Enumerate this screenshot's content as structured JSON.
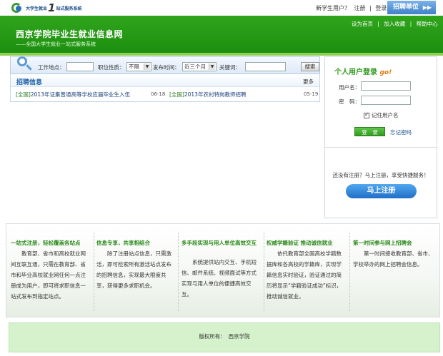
{
  "topbar": {
    "logo_left": "大学生就业",
    "logo_one": "1",
    "logo_right": "站式服务系统",
    "new_user": "新学生用户？",
    "register": "注册",
    "separator": "|",
    "login": "登录",
    "recruit_unit": "招聘单位",
    "recruit_arrow": "▶▶"
  },
  "banner": {
    "title": "西京学院毕业生就业信息网",
    "subtitle": "——全国大学生就业一站式服务系统",
    "links": [
      "设为首页",
      "|",
      "加入收藏",
      "|",
      "帮助中心"
    ]
  },
  "search": {
    "work_location_label": "工作地点：",
    "job_type_label": "职位性质：",
    "job_type_value": "不限",
    "publish_time_label": "发布时间：",
    "publish_time_value": "近三个月",
    "keyword_label": "关键词：",
    "search_button": "搜索"
  },
  "recruit_info": {
    "title": "招聘信息",
    "more": "更多",
    "jobs": [
      {
        "tag": "[全国]",
        "title": "2013年证集普通高等学校应届毕业生入伍",
        "date": "06-18"
      },
      {
        "tag": "[全国]",
        "title": "2013年农村特岗教师招聘",
        "date": "05-19"
      }
    ]
  },
  "login": {
    "title": "个人用户登录",
    "go": "go!",
    "username_label": "用户名：",
    "password_label": "密　码：",
    "remember_label": "记住用户名",
    "login_button": "登　录",
    "forgot_password": "忘记密码",
    "no_register_text": "还没有注册？马上注册，享受快捷服务！",
    "register_button": "马上注册"
  },
  "features": [
    {
      "title": "一站式注册，轻松覆盖各站点",
      "body": "教育部、省市和高校就业网间互联互通，只需在教育部、省市和毕业高校就业网任何一点注册成为用户，即可将求职信息一站式发布到指定站点。"
    },
    {
      "title": "信息专享，共享相结合",
      "body": "除了注册站点信息，只需激活，即可检索所有激活站点发布的招聘信息，实现最大限度共享，获得更多求职机会。"
    },
    {
      "title": "多手段实现与用人单位高效交互",
      "body": "系统提供站内交互、手机短信、邮件系统、视频面试等方式实现与用人单位的便捷高效交互。"
    },
    {
      "title": "权威学籍验证  推动诚信就业",
      "body": "依托教育部全国高校学籍数据库和各高校的学籍库，实现学籍信息实时验证，验证通过的简历将显示“学籍验证成功”标识，推动诚信就业。"
    },
    {
      "title": "第一时间参与网上招聘会",
      "body": "第一时间接收教育部、省市、学校举办的网上招聘会信息。"
    }
  ],
  "footer": {
    "copyright": "版权所有：　西京学院"
  }
}
